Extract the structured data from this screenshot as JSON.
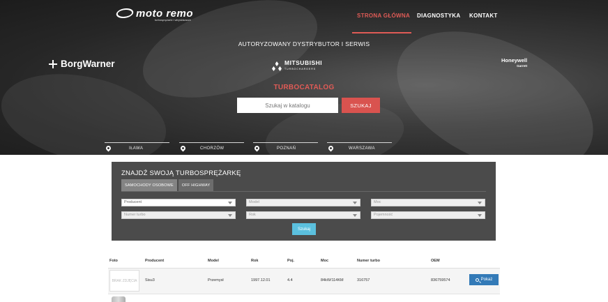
{
  "header": {
    "logo_text": "moto remo",
    "logo_subtext": "turbosprężarki i wtryskiwacze",
    "nav": [
      {
        "label": "STRONA GŁÓWNA",
        "active": true
      },
      {
        "label": "DIAGNOSTYKA",
        "active": false
      },
      {
        "label": "KONTAKT",
        "active": false
      }
    ]
  },
  "hero": {
    "tagline": "AUTORYZOWANY DYSTRYBUTOR I SERWIS",
    "brands": {
      "borgwarner": "BorgWarner",
      "mitsubishi": "MITSUBISHI",
      "mitsubishi_sub": "TURBOCHARGERS",
      "honeywell": "Honeywell",
      "honeywell_sub": "Garrett"
    },
    "catalog_title": "TURBOCATALOG",
    "search_placeholder": "Szukaj w katalogu",
    "search_button": "SZUKAJ",
    "locations": [
      "IŁAWA",
      "CHORZÓW",
      "POZNAŃ",
      "WARSZAWA"
    ]
  },
  "finder": {
    "title": "ZNAJDŹ SWOJĄ TURBOSPRĘŻARKĘ",
    "tabs": [
      {
        "label": "SAMOCHODY OSOBOWE",
        "active": true
      },
      {
        "label": "OFF HIGHWAY",
        "active": false
      }
    ],
    "selects": {
      "producent": "Producent",
      "model": "Model",
      "moc": "Moc",
      "numer_turbo": "Numer turbo",
      "rok": "Rok",
      "pojemnosc": "Pojemność"
    },
    "button": "Szukaj"
  },
  "results": {
    "columns": [
      "Foto",
      "Producent",
      "Model",
      "Rok",
      "Poj.",
      "Moc",
      "Numer turbo",
      "OEM"
    ],
    "rows": [
      {
        "photo_placeholder": "BRAK ZDJĘCIA",
        "producent": "Sisu3",
        "model": "Przemysł",
        "rok": "1997.12.01",
        "poj": "4.4",
        "moc": "84kW/114KM",
        "numer_turbo": "316757",
        "oem": "836759574",
        "button": "Pokaż"
      }
    ]
  },
  "colors": {
    "accent": "#e05b56",
    "search_button": "#d9534f",
    "finder_panel": "#4b4b4b",
    "finder_button": "#5bc0de",
    "show_button": "#337ab7"
  }
}
